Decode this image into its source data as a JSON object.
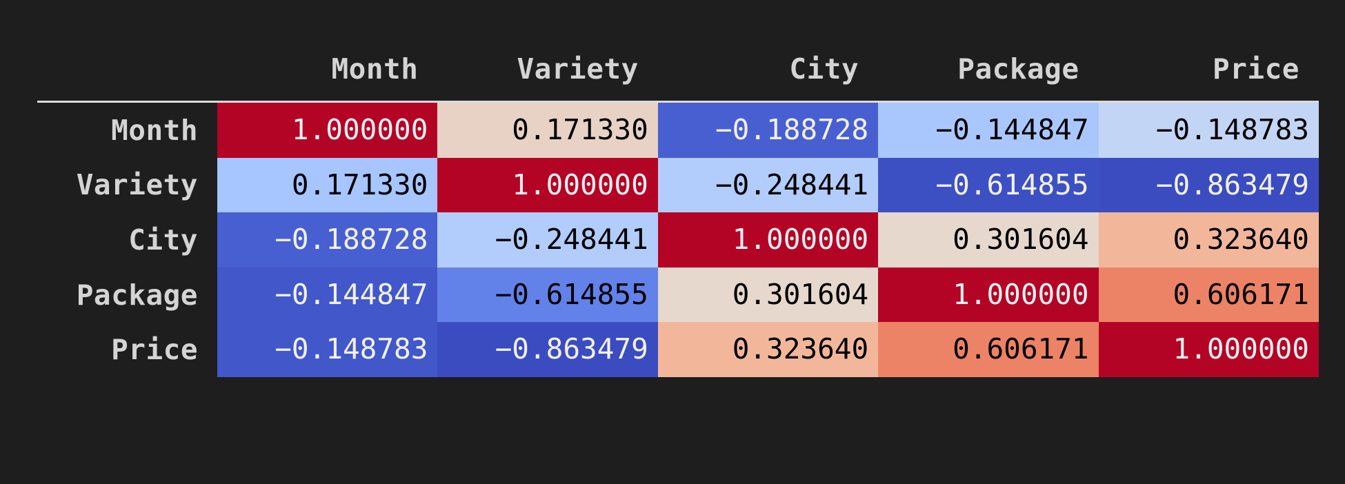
{
  "chart_data": {
    "type": "heatmap",
    "title": "",
    "subtitle": "",
    "xlabel": "",
    "ylabel": "",
    "grid": false,
    "legend": "none",
    "colormap": "coolwarm",
    "value_range": [
      -1.0,
      1.0
    ],
    "categories": [
      "Month",
      "Variety",
      "City",
      "Package",
      "Price"
    ],
    "row_labels": [
      "Month",
      "Variety",
      "City",
      "Package",
      "Price"
    ],
    "column_labels": [
      "Month",
      "Variety",
      "City",
      "Package",
      "Price"
    ],
    "matrix": [
      [
        1.0,
        0.17133,
        -0.188728,
        -0.144847,
        -0.148783
      ],
      [
        0.17133,
        1.0,
        -0.248441,
        -0.614855,
        -0.863479
      ],
      [
        -0.188728,
        -0.248441,
        1.0,
        0.301604,
        0.32364
      ],
      [
        -0.144847,
        -0.614855,
        0.301604,
        1.0,
        0.606171
      ],
      [
        -0.148783,
        -0.863479,
        0.32364,
        0.606171,
        1.0
      ]
    ],
    "cell_text": [
      [
        "1.000000",
        "0.171330",
        "−0.188728",
        "−0.144847",
        "−0.148783"
      ],
      [
        "0.171330",
        "1.000000",
        "−0.248441",
        "−0.614855",
        "−0.863479"
      ],
      [
        "−0.188728",
        "−0.248441",
        "1.000000",
        "0.301604",
        "0.323640"
      ],
      [
        "−0.144847",
        "−0.614855",
        "0.301604",
        "1.000000",
        "0.606171"
      ],
      [
        "−0.148783",
        "−0.863479",
        "0.323640",
        "0.606171",
        "1.000000"
      ]
    ],
    "cell_bg": [
      [
        "#b40426",
        "#e8d2c5",
        "#485fd1",
        "#aac7fd",
        "#c3d5f4"
      ],
      [
        "#a7c5fe",
        "#b40426",
        "#b2ccfb",
        "#3d50c3",
        "#3b4cc0"
      ],
      [
        "#485fd1",
        "#b2ccfb",
        "#b40426",
        "#e7d8ce",
        "#f2b79b"
      ],
      [
        "#4257c9",
        "#6282ea",
        "#e7d8ce",
        "#b40426",
        "#ed8366"
      ],
      [
        "#4257c9",
        "#3b4cc0",
        "#f2b79b",
        "#ed8366",
        "#b40426"
      ]
    ],
    "cell_fg": [
      [
        "#f1f1f1",
        "#000000",
        "#f1f1f1",
        "#000000",
        "#000000"
      ],
      [
        "#000000",
        "#f1f1f1",
        "#000000",
        "#f1f1f1",
        "#f1f1f1"
      ],
      [
        "#f1f1f1",
        "#000000",
        "#f1f1f1",
        "#000000",
        "#000000"
      ],
      [
        "#f1f1f1",
        "#000000",
        "#000000",
        "#f1f1f1",
        "#000000"
      ],
      [
        "#f1f1f1",
        "#f1f1f1",
        "#000000",
        "#000000",
        "#f1f1f1"
      ]
    ]
  },
  "style": {
    "background": "#1e1e1e",
    "header_text_color": "#d4d4d4",
    "rule_color": "#dcdcdc",
    "accent_high": "#b40426",
    "accent_low": "#3b4cc0"
  }
}
